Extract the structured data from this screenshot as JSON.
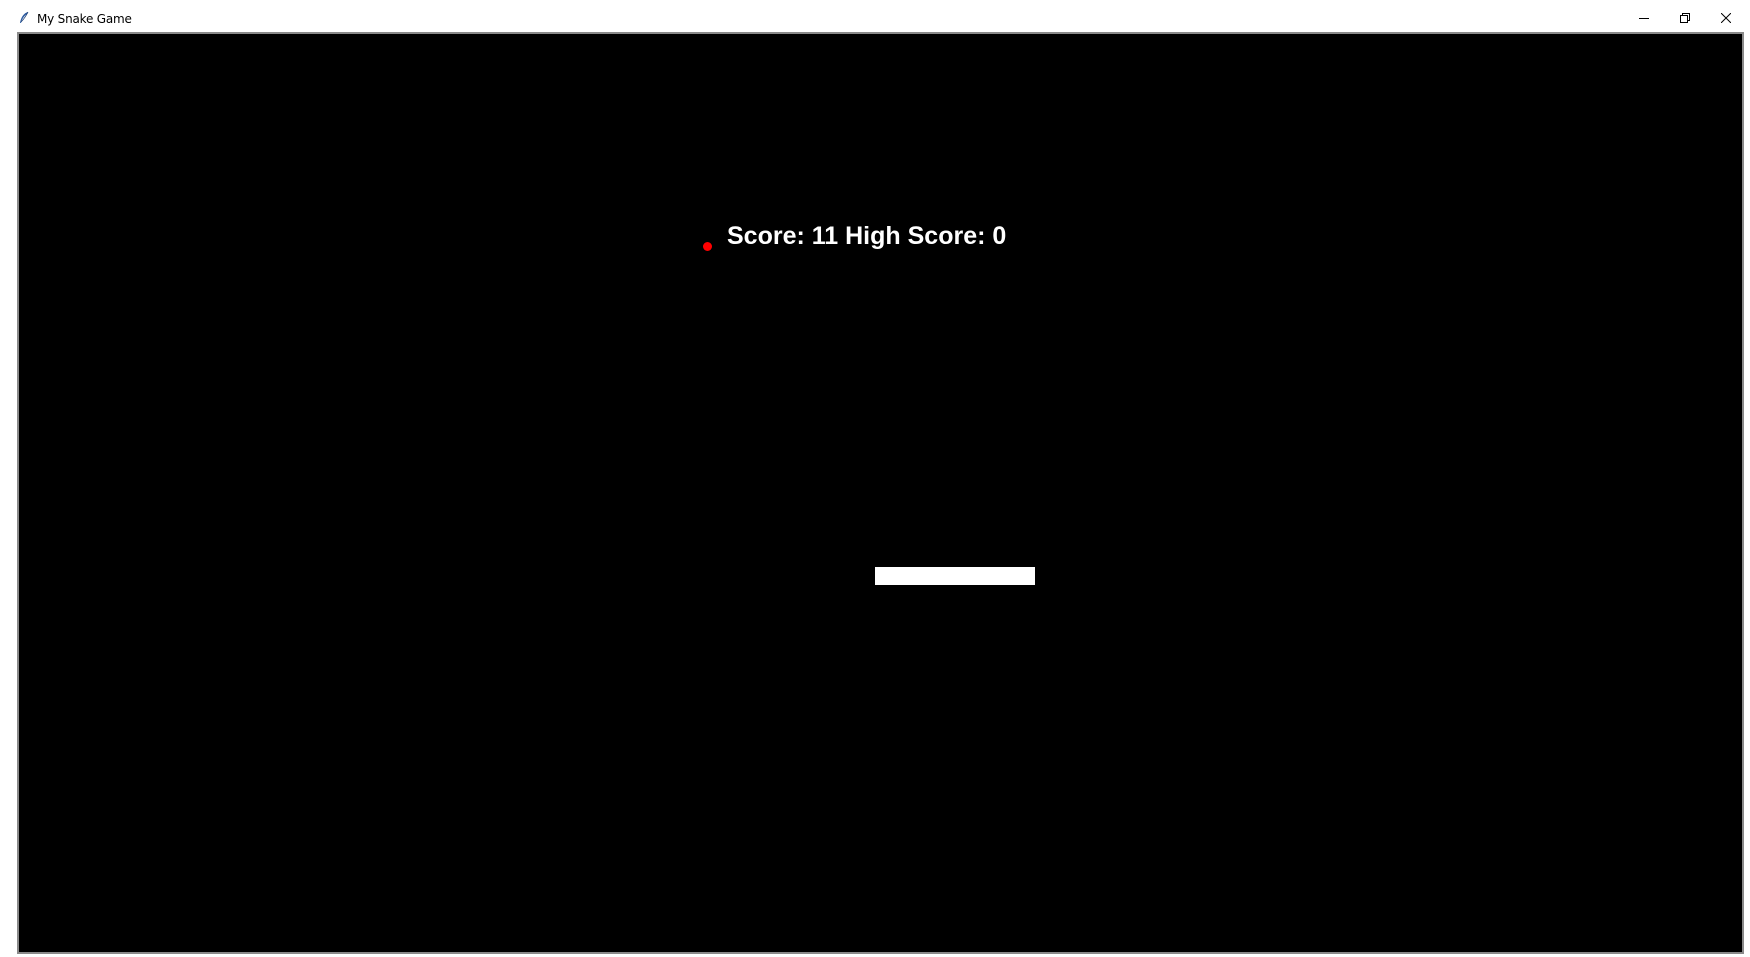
{
  "window": {
    "title": "My Snake Game",
    "icons": {
      "app": "feather-icon",
      "minimize": "minimize-icon",
      "maximize": "restore-icon",
      "close": "close-icon"
    }
  },
  "game": {
    "score_label": "Score: 11 High Score: 0",
    "score": 11,
    "high_score": 0,
    "colors": {
      "background": "#000000",
      "snake": "#ffffff",
      "food": "#ff0000",
      "text": "#ffffff"
    }
  }
}
